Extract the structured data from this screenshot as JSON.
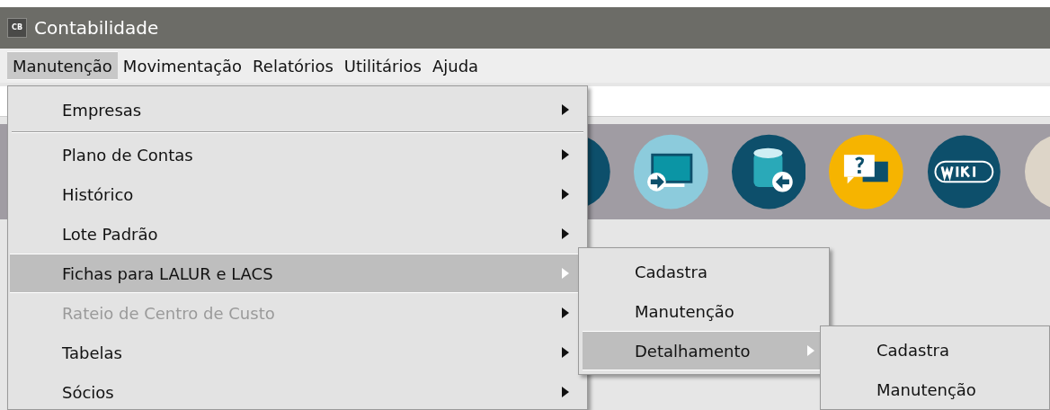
{
  "window": {
    "title": "Contabilidade",
    "logo": "CB"
  },
  "menu_bar": [
    {
      "label": "Manutenção",
      "selected": true
    },
    {
      "label": "Movimentação",
      "selected": false
    },
    {
      "label": "Relatórios",
      "selected": false
    },
    {
      "label": "Utilitários",
      "selected": false
    },
    {
      "label": "Ajuda",
      "selected": false
    }
  ],
  "menu": [
    {
      "kind": "item",
      "label": "Empresas",
      "disabled": false,
      "selected": false
    },
    {
      "kind": "separator"
    },
    {
      "kind": "item",
      "label": "Plano de Contas",
      "disabled": false,
      "selected": false
    },
    {
      "kind": "item",
      "label": "Histórico",
      "disabled": false,
      "selected": false
    },
    {
      "kind": "item",
      "label": "Lote Padrão",
      "disabled": false,
      "selected": false
    },
    {
      "kind": "item",
      "label": "Fichas para LALUR e LACS",
      "disabled": false,
      "selected": true
    },
    {
      "kind": "item",
      "label": "Rateio de Centro de Custo",
      "disabled": true,
      "selected": false
    },
    {
      "kind": "item",
      "label": "Tabelas",
      "disabled": false,
      "selected": false
    },
    {
      "kind": "item",
      "label": "Sócios",
      "disabled": false,
      "selected": false
    }
  ],
  "submenu": [
    {
      "label": "Cadastra",
      "has_submenu": false,
      "selected": false
    },
    {
      "label": "Manutenção",
      "has_submenu": false,
      "selected": false
    },
    {
      "label": "Detalhamento",
      "has_submenu": true,
      "selected": true
    }
  ],
  "submenu_2": [
    {
      "label": "Cadastra",
      "selected": false
    },
    {
      "label": "Manutenção",
      "selected": false
    }
  ]
}
